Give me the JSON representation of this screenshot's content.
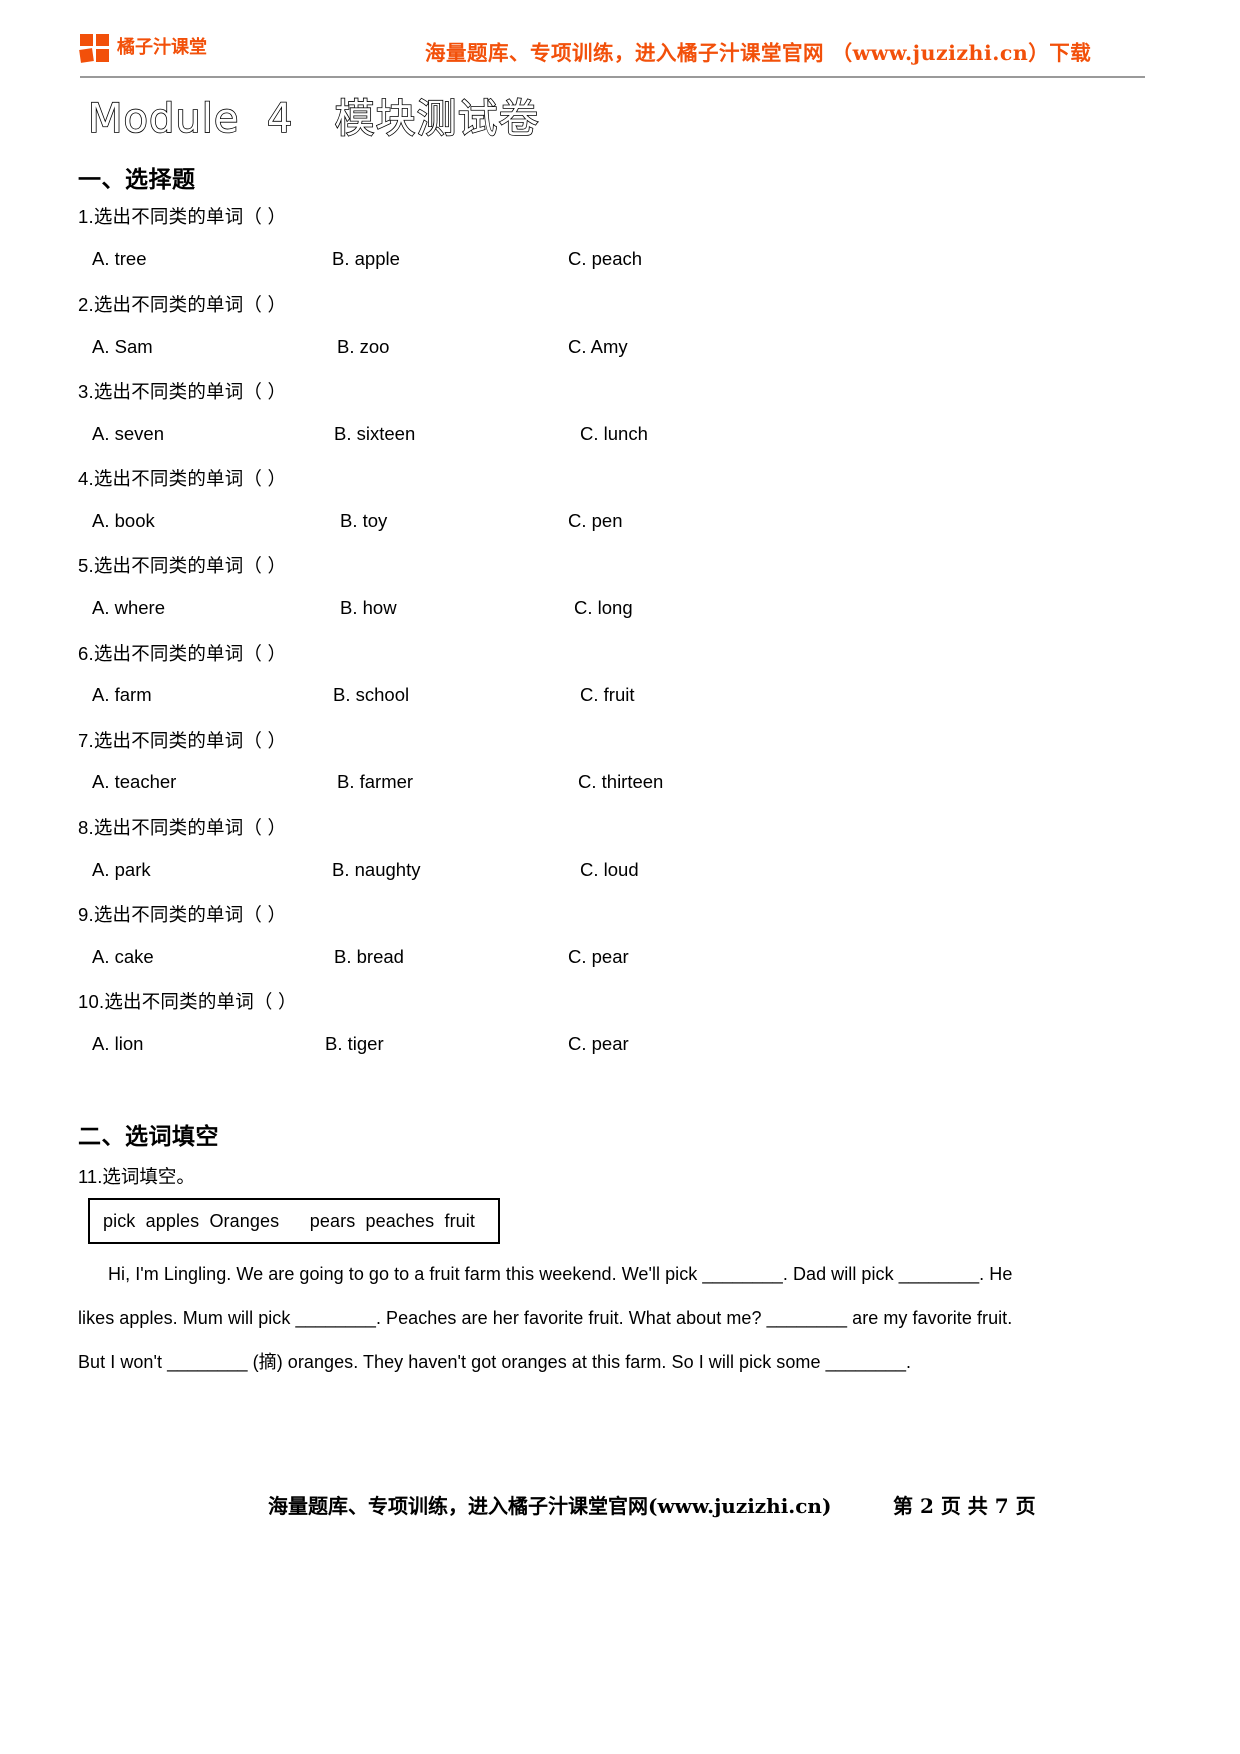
{
  "header": {
    "brand_name": "橘子汁课堂",
    "slogan": "海量题库、专项训练，进入橘子汁课堂官网 （www.juzizhi.cn）下载",
    "brand_color": "#F2500A"
  },
  "title": "Module  4   模块测试卷",
  "sections": [
    {
      "id": "sec1",
      "heading": "一、选择题"
    },
    {
      "id": "sec2",
      "heading": "二、选词填空"
    }
  ],
  "questions": [
    {
      "stem": "1.选出不同类的单词（      ）",
      "options": [
        "A. tree",
        "B. apple",
        "C. peach"
      ]
    },
    {
      "stem": "2.选出不同类的单词（      ）",
      "options": [
        "A. Sam",
        "B. zoo",
        "C. Amy"
      ]
    },
    {
      "stem": "3.选出不同类的单词（      ）",
      "options": [
        "A. seven",
        "B. sixteen",
        "C. lunch"
      ]
    },
    {
      "stem": "4.选出不同类的单词（      ）",
      "options": [
        "A. book",
        "B. toy",
        "C. pen"
      ]
    },
    {
      "stem": "5.选出不同类的单词（      ）",
      "options": [
        "A. where",
        "B. how",
        "C. long"
      ]
    },
    {
      "stem": "6.选出不同类的单词（      ）",
      "options": [
        "A. farm",
        "B. school",
        "C. fruit"
      ]
    },
    {
      "stem": "7.选出不同类的单词（      ）",
      "options": [
        "A. teacher",
        "B. farmer",
        "C. thirteen"
      ]
    },
    {
      "stem": "8.选出不同类的单词（      ）",
      "options": [
        "A. park",
        "B. naughty",
        "C. loud"
      ]
    },
    {
      "stem": "9.选出不同类的单词（      ）",
      "options": [
        "A. cake",
        "B. bread",
        "C. pear"
      ]
    },
    {
      "stem": "10.选出不同类的单词（      ）",
      "options": [
        "A. lion",
        "B. tiger",
        "C. pear"
      ]
    }
  ],
  "cloze": {
    "stem": "11.选词填空。",
    "word_bank": "pick  apples  Oranges      pears  peaches  fruit",
    "passage_lines": [
      "Hi, I'm Lingling. We are going to go to a fruit farm this weekend. We'll pick ________. Dad will pick ________. He",
      "likes apples. Mum will pick ________. Peaches are her favorite fruit. What about me? ________ are my favorite fruit.",
      "But I won't ________ (摘) oranges. They haven't got oranges at this farm. So I will pick some ________."
    ]
  },
  "footer": {
    "left": "海量题库、专项训练，进入橘子汁课堂官网(www.juzizhi.cn)",
    "right": "第 2 页 共 7 页"
  }
}
